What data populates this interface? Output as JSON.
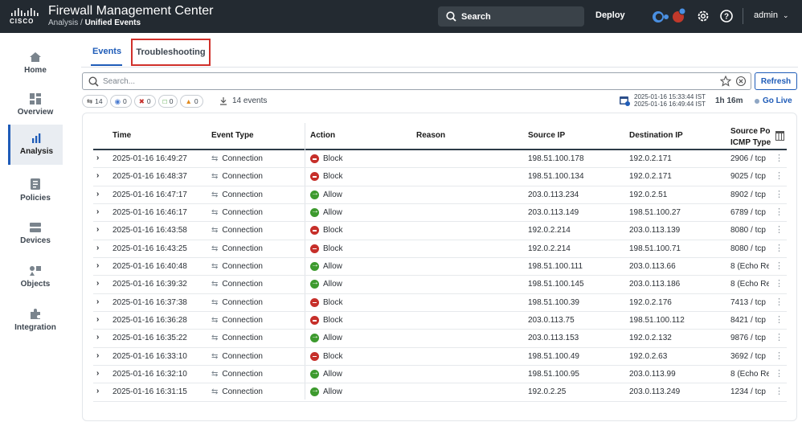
{
  "header": {
    "app_title": "Firewall Management Center",
    "breadcrumb_parent": "Analysis /",
    "breadcrumb_current": "Unified Events",
    "search_label": "Search",
    "deploy_label": "Deploy",
    "notification_count": "",
    "user": "admin"
  },
  "sidebar": {
    "items": [
      {
        "label": "Home",
        "icon": "home-icon"
      },
      {
        "label": "Overview",
        "icon": "overview-icon"
      },
      {
        "label": "Analysis",
        "icon": "analysis-icon",
        "active": true
      },
      {
        "label": "Policies",
        "icon": "policies-icon"
      },
      {
        "label": "Devices",
        "icon": "devices-icon"
      },
      {
        "label": "Objects",
        "icon": "objects-icon"
      },
      {
        "label": "Integration",
        "icon": "integration-icon"
      }
    ]
  },
  "tabs": {
    "events": "Events",
    "troubleshooting": "Troubleshooting"
  },
  "filter": {
    "placeholder": "Search...",
    "refresh_label": "Refresh"
  },
  "chips": [
    "14",
    "0",
    "0",
    "0",
    "0"
  ],
  "summary": {
    "events_count": "14 events",
    "range_start": "2025-01-16 15:33:44 IST",
    "range_end": "2025-01-16 16:49:44 IST",
    "duration": "1h 16m",
    "go_live": "Go Live"
  },
  "table": {
    "columns": {
      "time": "Time",
      "event_type": "Event Type",
      "action": "Action",
      "reason": "Reason",
      "source_ip": "Source IP",
      "destination_ip": "Destination IP",
      "source_port_line1": "Source Port /",
      "source_port_line2": "ICMP Type"
    },
    "rows": [
      {
        "time": "2025-01-16 16:49:27",
        "type": "Connection",
        "action": "Block",
        "src": "198.51.100.178",
        "dst": "192.0.2.171",
        "port": "2906 / tcp"
      },
      {
        "time": "2025-01-16 16:48:37",
        "type": "Connection",
        "action": "Block",
        "src": "198.51.100.134",
        "dst": "192.0.2.171",
        "port": "9025 / tcp"
      },
      {
        "time": "2025-01-16 16:47:17",
        "type": "Connection",
        "action": "Allow",
        "src": "203.0.113.234",
        "dst": "192.0.2.51",
        "port": "8902 / tcp"
      },
      {
        "time": "2025-01-16 16:46:17",
        "type": "Connection",
        "action": "Allow",
        "src": "203.0.113.149",
        "dst": "198.51.100.27",
        "port": "6789 / tcp"
      },
      {
        "time": "2025-01-16 16:43:58",
        "type": "Connection",
        "action": "Block",
        "src": "192.0.2.214",
        "dst": "203.0.113.139",
        "port": "8080 / tcp"
      },
      {
        "time": "2025-01-16 16:43:25",
        "type": "Connection",
        "action": "Block",
        "src": "192.0.2.214",
        "dst": "198.51.100.71",
        "port": "8080 / tcp"
      },
      {
        "time": "2025-01-16 16:40:48",
        "type": "Connection",
        "action": "Allow",
        "src": "198.51.100.111",
        "dst": "203.0.113.66",
        "port": "8 (Echo Re"
      },
      {
        "time": "2025-01-16 16:39:32",
        "type": "Connection",
        "action": "Allow",
        "src": "198.51.100.145",
        "dst": "203.0.113.186",
        "port": "8 (Echo Re"
      },
      {
        "time": "2025-01-16 16:37:38",
        "type": "Connection",
        "action": "Block",
        "src": "198.51.100.39",
        "dst": "192.0.2.176",
        "port": "7413 / tcp"
      },
      {
        "time": "2025-01-16 16:36:28",
        "type": "Connection",
        "action": "Block",
        "src": "203.0.113.75",
        "dst": "198.51.100.112",
        "port": "8421 / tcp"
      },
      {
        "time": "2025-01-16 16:35:22",
        "type": "Connection",
        "action": "Allow",
        "src": "203.0.113.153",
        "dst": "192.0.2.132",
        "port": "9876 / tcp"
      },
      {
        "time": "2025-01-16 16:33:10",
        "type": "Connection",
        "action": "Block",
        "src": "198.51.100.49",
        "dst": "192.0.2.63",
        "port": "3692 / tcp"
      },
      {
        "time": "2025-01-16 16:32:10",
        "type": "Connection",
        "action": "Allow",
        "src": "198.51.100.95",
        "dst": "203.0.113.99",
        "port": "8 (Echo Re"
      },
      {
        "time": "2025-01-16 16:31:15",
        "type": "Connection",
        "action": "Allow",
        "src": "192.0.2.25",
        "dst": "203.0.113.249",
        "port": "1234 / tcp"
      }
    ]
  },
  "colors": {
    "topbar": "#232a31",
    "accent": "#1f5cb8",
    "block": "#c62f2a",
    "allow": "#3d9a2e",
    "highlight": "#d0302b"
  }
}
